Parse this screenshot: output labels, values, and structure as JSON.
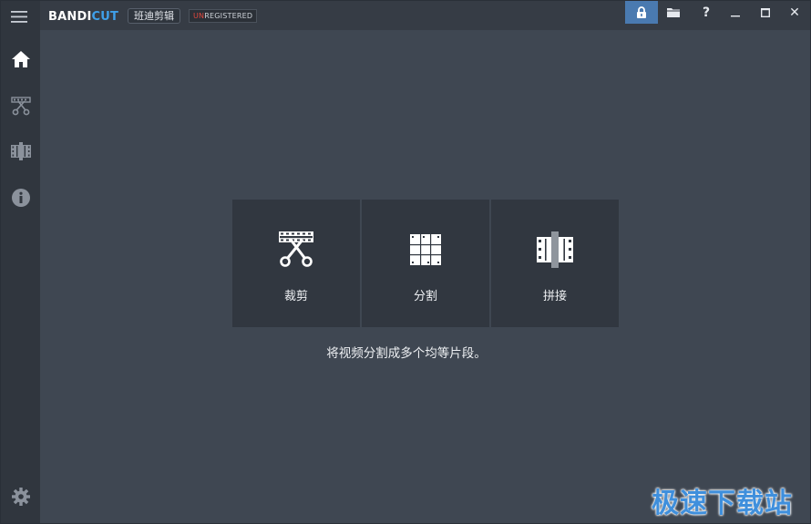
{
  "app": {
    "logo_main": "BANDI",
    "logo_accent": "CUT",
    "cn_name": "班迪剪辑",
    "reg_prefix": "UN",
    "reg_rest": "REGISTERED"
  },
  "titlebar": {
    "help_label": "?",
    "close_label": "✕",
    "icons": [
      "lock-icon",
      "folder-icon",
      "help-icon",
      "minimize-icon",
      "maximize-icon",
      "close-icon"
    ]
  },
  "sidebar": {
    "items": [
      {
        "name": "home",
        "icon": "home-icon",
        "active": true
      },
      {
        "name": "cut",
        "icon": "scissors-film-icon",
        "active": false
      },
      {
        "name": "join",
        "icon": "film-join-icon",
        "active": false
      },
      {
        "name": "info",
        "icon": "info-icon",
        "active": false
      }
    ],
    "bottom_icon": "gear-icon"
  },
  "cards": [
    {
      "label": "裁剪",
      "icon": "scissors-film-icon"
    },
    {
      "label": "分割",
      "icon": "grid-split-icon"
    },
    {
      "label": "拼接",
      "icon": "film-join-icon"
    }
  ],
  "hint": "将视频分割成多个均等片段。",
  "watermark": "极速下载站",
  "colors": {
    "background": "#3f4752",
    "sidebar": "#30363e",
    "card": "#313740",
    "accent": "#3fa0ea",
    "lock_button": "#4a7ab0"
  }
}
